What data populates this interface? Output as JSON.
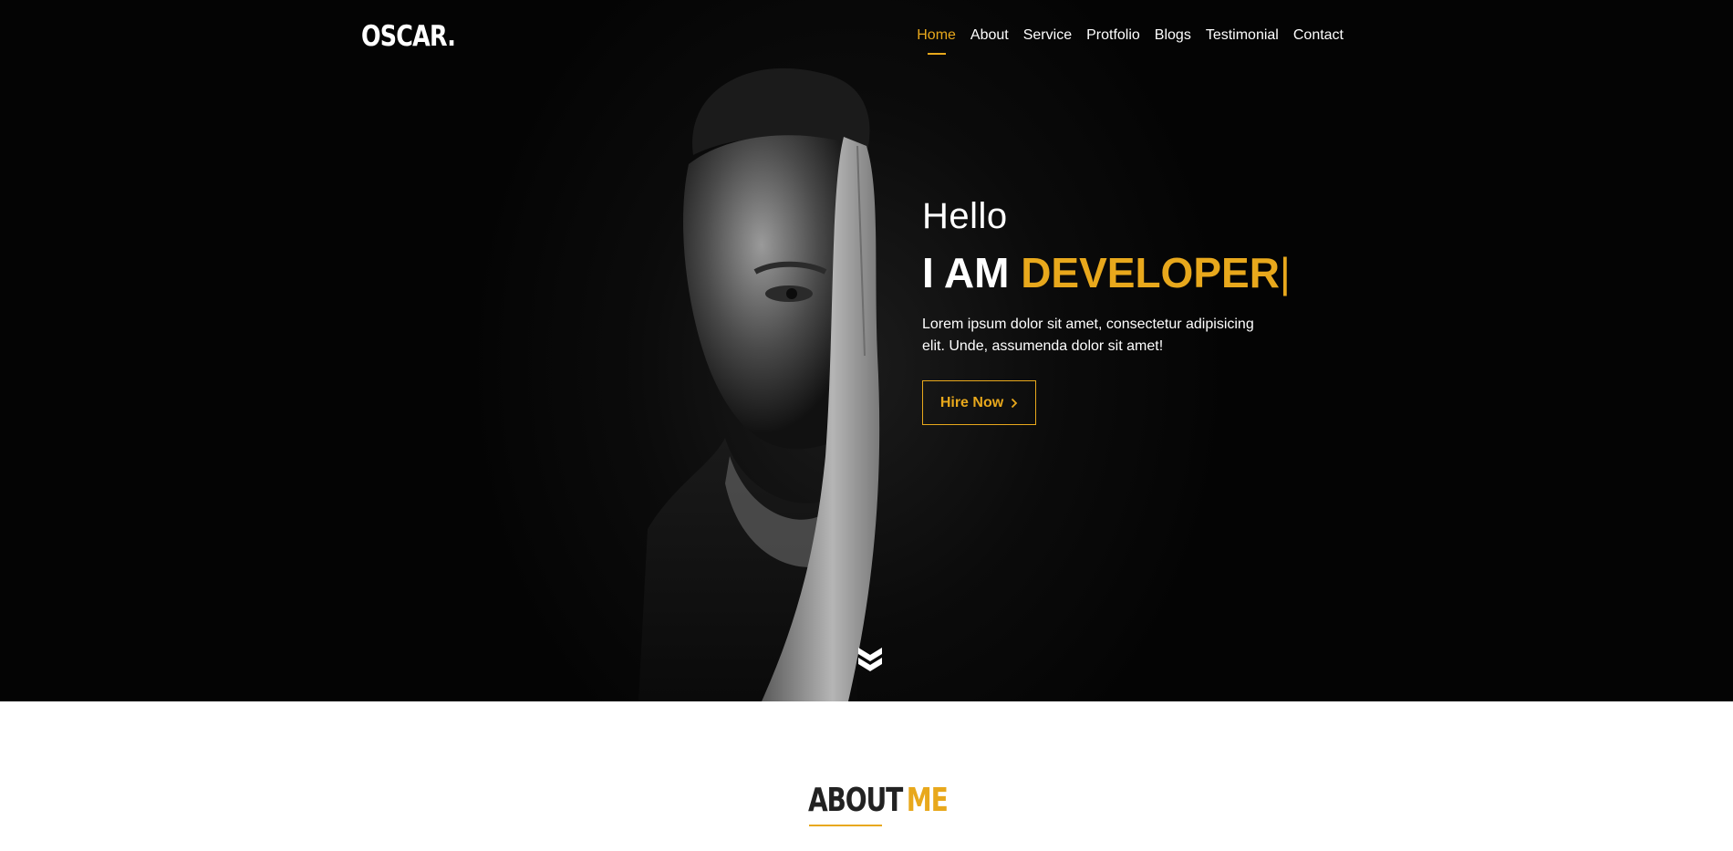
{
  "brand": {
    "logo": "OSCAR."
  },
  "nav": {
    "items": [
      {
        "label": "Home",
        "active": true
      },
      {
        "label": "About",
        "active": false
      },
      {
        "label": "Service",
        "active": false
      },
      {
        "label": "Protfolio",
        "active": false
      },
      {
        "label": "Blogs",
        "active": false
      },
      {
        "label": "Testimonial",
        "active": false
      },
      {
        "label": "Contact",
        "active": false
      }
    ]
  },
  "hero": {
    "greeting": "Hello",
    "headline_prefix": "I AM",
    "headline_role": "DEVELOPER",
    "cursor": "|",
    "description": "Lorem ipsum dolor sit amet, consectetur adipisicing elit. Unde, assumenda dolor sit amet!",
    "button_label": "Hire Now",
    "button_icon": "chevron-right-icon",
    "scroll_icon": "double-chevron-down-icon"
  },
  "about": {
    "title_part1": "ABOUT",
    "title_part2": "ME"
  },
  "colors": {
    "accent": "#e8a81c",
    "hero_bg": "#050505",
    "text_light": "#ffffff",
    "text_dark": "#222222"
  }
}
